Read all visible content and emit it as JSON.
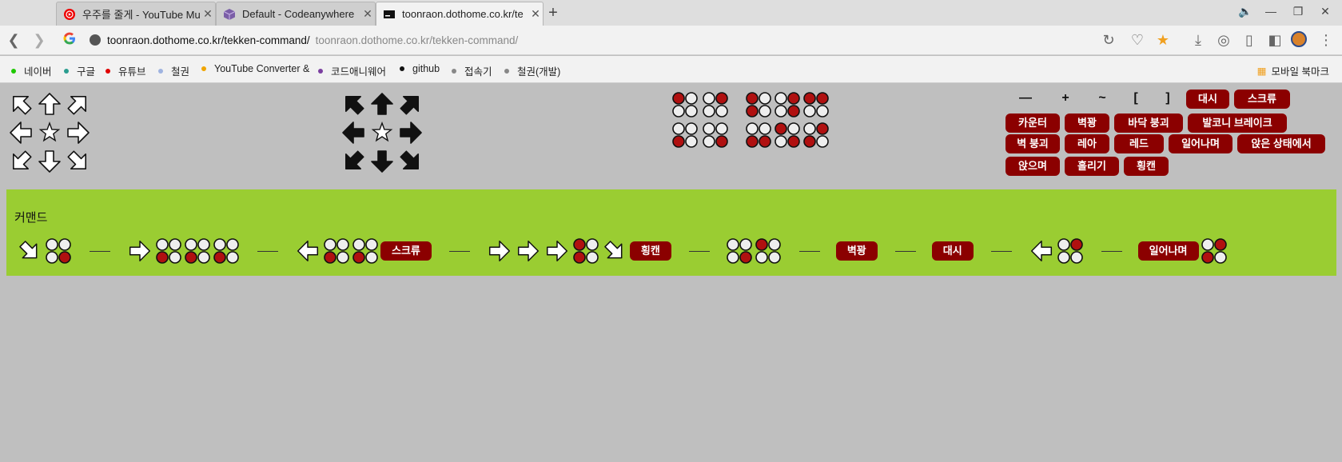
{
  "browser": {
    "tabs": [
      {
        "title": "우주를 줄게 - YouTube Mu",
        "icon": "youtube-music-icon"
      },
      {
        "title": "Default - Codeanywhere",
        "icon": "codeanywhere-cube-icon"
      },
      {
        "title": "toonraon.dothome.co.kr/te",
        "icon": "terminal-icon"
      }
    ],
    "new_tab_label": "+",
    "address": {
      "host_text": "toonraon.dothome.co.kr/tekken-command/",
      "ghost_text": "toonraon.dothome.co.kr/tekken-command/"
    },
    "bookmarks": [
      {
        "label": "네이버",
        "color": "#1ec800"
      },
      {
        "label": "구글",
        "color": "#2a9d8f"
      },
      {
        "label": "유튜브",
        "color": "#e00000"
      },
      {
        "label": "철권",
        "color": "#9fb3e0"
      },
      {
        "label": "YouTube Converter &",
        "color": "#f0a500"
      },
      {
        "label": "코드애니웨어",
        "color": "#7b3fa0"
      },
      {
        "label": "github",
        "color": "#111111"
      },
      {
        "label": "접속기",
        "color": "#888888"
      },
      {
        "label": "철권(개발)",
        "color": "#888888"
      }
    ],
    "mobile_bookmarks_label": "모바일 북마크"
  },
  "palette": {
    "symbols": [
      "—",
      "+",
      "~",
      "[",
      "]"
    ],
    "buttons_row1": [
      "대시",
      "스크류"
    ],
    "buttons_row2": [
      "카운터",
      "벽꽝",
      "바닥 붕괴",
      "발코니 브레이크"
    ],
    "buttons_row3": [
      "벽 붕괴",
      "레아",
      "레드",
      "일어나며",
      "앉은 상태에서"
    ],
    "buttons_row4": [
      "앉으며",
      "흘리기",
      "횡캔"
    ]
  },
  "command": {
    "title": "커맨드",
    "sequence": [
      {
        "kind": "arrow",
        "dir": "dr"
      },
      {
        "kind": "pad",
        "on": [
          4
        ]
      },
      {
        "kind": "sep",
        "text": "—"
      },
      {
        "kind": "arrow",
        "dir": "r"
      },
      {
        "kind": "pad",
        "on": [
          3
        ]
      },
      {
        "kind": "pad",
        "on": [
          3
        ]
      },
      {
        "kind": "pad",
        "on": [
          3
        ]
      },
      {
        "kind": "sep",
        "text": "—"
      },
      {
        "kind": "arrow",
        "dir": "l"
      },
      {
        "kind": "pad",
        "on": [
          3
        ]
      },
      {
        "kind": "pad",
        "on": [
          3
        ]
      },
      {
        "kind": "btn",
        "text": "스크류"
      },
      {
        "kind": "sep",
        "text": "—"
      },
      {
        "kind": "arrow",
        "dir": "r"
      },
      {
        "kind": "arrow",
        "dir": "r"
      },
      {
        "kind": "arrow",
        "dir": "r"
      },
      {
        "kind": "pad",
        "on": [
          1,
          3
        ]
      },
      {
        "kind": "arrow",
        "dir": "dr"
      },
      {
        "kind": "btn",
        "text": "횡캔"
      },
      {
        "kind": "sep",
        "text": "—"
      },
      {
        "kind": "pad",
        "on": [
          4
        ]
      },
      {
        "kind": "pad",
        "on": [
          1
        ]
      },
      {
        "kind": "sep",
        "text": "—"
      },
      {
        "kind": "btn",
        "text": "벽꽝"
      },
      {
        "kind": "sep",
        "text": "—"
      },
      {
        "kind": "btn",
        "text": "대시"
      },
      {
        "kind": "sep",
        "text": "—"
      },
      {
        "kind": "arrow",
        "dir": "l"
      },
      {
        "kind": "pad",
        "on": [
          2
        ]
      },
      {
        "kind": "sep",
        "text": "—"
      },
      {
        "kind": "btn",
        "text": "일어나며"
      },
      {
        "kind": "pad",
        "on": [
          2,
          3
        ]
      }
    ]
  }
}
